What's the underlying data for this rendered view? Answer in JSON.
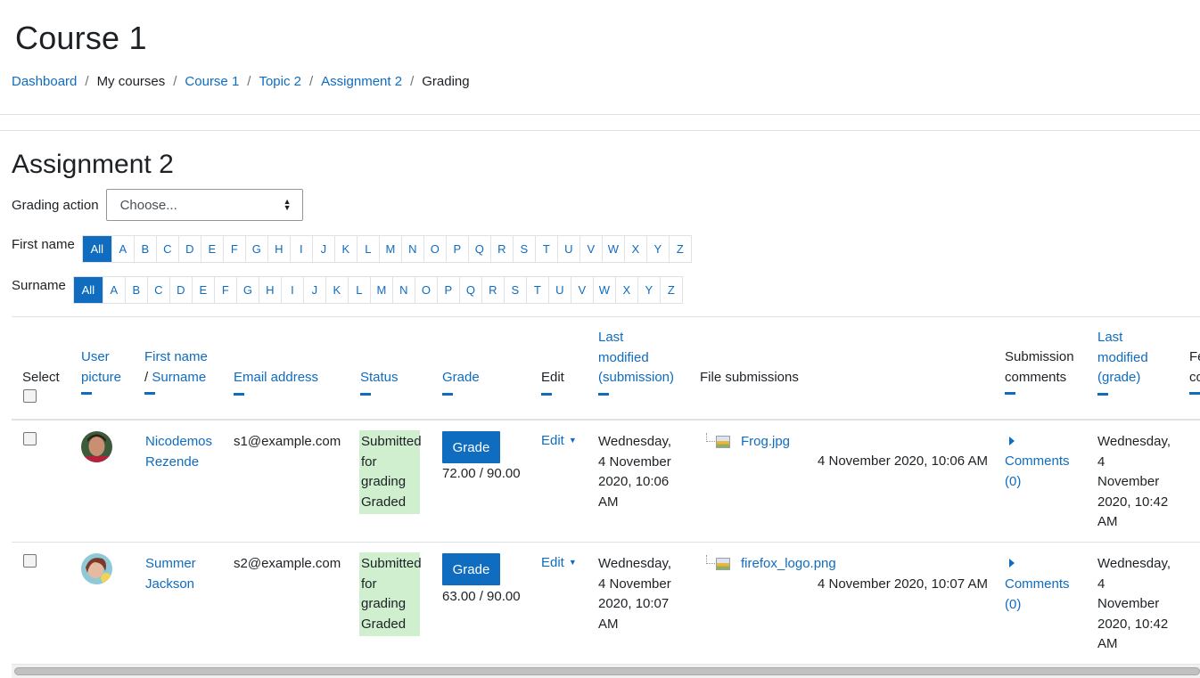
{
  "page": {
    "title": "Course 1"
  },
  "breadcrumb": [
    {
      "label": "Dashboard",
      "link": true
    },
    {
      "label": "My courses",
      "link": false
    },
    {
      "label": "Course 1",
      "link": true
    },
    {
      "label": "Topic 2",
      "link": true
    },
    {
      "label": "Assignment 2",
      "link": true
    },
    {
      "label": "Grading",
      "link": false
    }
  ],
  "assignment": {
    "title": "Assignment 2"
  },
  "grading_action": {
    "label": "Grading action",
    "selected": "Choose..."
  },
  "first_name_filter": {
    "label": "First name",
    "letters": [
      "All",
      "A",
      "B",
      "C",
      "D",
      "E",
      "F",
      "G",
      "H",
      "I",
      "J",
      "K",
      "L",
      "M",
      "N",
      "O",
      "P",
      "Q",
      "R",
      "S",
      "T",
      "U",
      "V",
      "W",
      "X",
      "Y",
      "Z"
    ],
    "active": "All"
  },
  "surname_filter": {
    "label": "Surname",
    "letters": [
      "All",
      "A",
      "B",
      "C",
      "D",
      "E",
      "F",
      "G",
      "H",
      "I",
      "J",
      "K",
      "L",
      "M",
      "N",
      "O",
      "P",
      "Q",
      "R",
      "S",
      "T",
      "U",
      "V",
      "W",
      "X",
      "Y",
      "Z"
    ],
    "active": "All"
  },
  "table": {
    "headers": {
      "select": "Select",
      "user_picture_1": "User",
      "user_picture_2": "picture",
      "first_name": "First name",
      "slash": "/",
      "surname": "Surname",
      "email": "Email address",
      "status": "Status",
      "grade": "Grade",
      "edit": "Edit",
      "last_mod_sub_1": "Last",
      "last_mod_sub_2": "modified",
      "last_mod_sub_3": "(submission)",
      "file_submissions": "File submissions",
      "sub_comments_1": "Submission",
      "sub_comments_2": "comments",
      "last_mod_grade_1": "Last",
      "last_mod_grade_2": "modified",
      "last_mod_grade_3": "(grade)",
      "feedback_cut_1": "Fe",
      "feedback_cut_2": "co"
    },
    "rows": [
      {
        "first_name": "Nicodemos",
        "surname": "Rezende",
        "email": "s1@example.com",
        "status_1": "Submitted",
        "status_2": "for",
        "status_3": "grading",
        "status_4": "Graded",
        "grade_button": "Grade",
        "grade_value": "72.00 / 90.00",
        "edit": "Edit",
        "modified_sub_1": "Wednesday,",
        "modified_sub_2": "4 November",
        "modified_sub_3": "2020, 10:06",
        "modified_sub_4": "AM",
        "file_name": "Frog.jpg",
        "file_date": "4 November 2020, 10:06 AM",
        "comments": "Comments",
        "comments_count": "(0)",
        "modified_grade_1": "Wednesday,",
        "modified_grade_2": "4",
        "modified_grade_3": "November",
        "modified_grade_4": "2020, 10:42",
        "modified_grade_5": "AM"
      },
      {
        "first_name": "Summer",
        "surname": "Jackson",
        "email": "s2@example.com",
        "status_1": "Submitted",
        "status_2": "for",
        "status_3": "grading",
        "status_4": "Graded",
        "grade_button": "Grade",
        "grade_value": "63.00 / 90.00",
        "edit": "Edit",
        "modified_sub_1": "Wednesday,",
        "modified_sub_2": "4 November",
        "modified_sub_3": "2020, 10:07",
        "modified_sub_4": "AM",
        "file_name": "firefox_logo.png",
        "file_date": "4 November 2020, 10:07 AM",
        "comments": "Comments",
        "comments_count": "(0)",
        "modified_grade_1": "Wednesday,",
        "modified_grade_2": "4",
        "modified_grade_3": "November",
        "modified_grade_4": "2020, 10:42",
        "modified_grade_5": "AM"
      }
    ]
  },
  "colors": {
    "link": "#0f6cbf",
    "status_bg": "#cfefcf",
    "text": "#1d2125"
  }
}
